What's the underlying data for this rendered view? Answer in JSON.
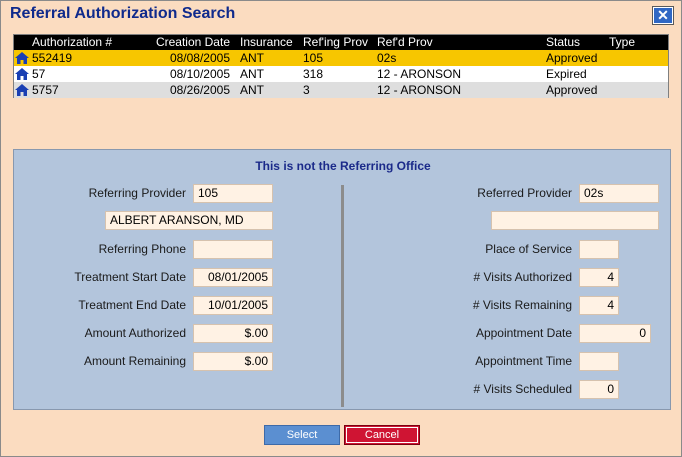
{
  "window": {
    "title": "Referral Authorization Search",
    "close_label": "✕"
  },
  "grid": {
    "headers": {
      "auth": "Authorization #",
      "date": "Creation Date",
      "ins": "Insurance",
      "refing": "Ref'ing Prov",
      "refd": "Ref'd Prov",
      "status": "Status",
      "type": "Type"
    },
    "rows": [
      {
        "auth": "552419",
        "date": "08/08/2005",
        "ins": "ANT",
        "refing": "105",
        "refd": "02s",
        "status": "Approved",
        "type": ""
      },
      {
        "auth": "57",
        "date": "08/10/2005",
        "ins": "ANT",
        "refing": "318",
        "refd": "12 - ARONSON",
        "status": "Expired",
        "type": ""
      },
      {
        "auth": "5757",
        "date": "08/26/2005",
        "ins": "ANT",
        "refing": "3",
        "refd": "12 - ARONSON",
        "status": "Approved",
        "type": ""
      }
    ],
    "row_icon": "house-icon",
    "selected_row_color": "#f7c600"
  },
  "detail": {
    "notice": "This is not the Referring Office",
    "left": {
      "referring_provider_label": "Referring Provider",
      "referring_provider_value": "105",
      "referring_provider_name": "ALBERT ARANSON, MD",
      "referring_phone_label": "Referring Phone",
      "referring_phone_value": "",
      "treatment_start_label": "Treatment Start Date",
      "treatment_start_value": "08/01/2005",
      "treatment_end_label": "Treatment End Date",
      "treatment_end_value": "10/01/2005",
      "amount_authorized_label": "Amount Authorized",
      "amount_authorized_value": "$.00",
      "amount_remaining_label": "Amount Remaining",
      "amount_remaining_value": "$.00"
    },
    "right": {
      "referred_provider_label": "Referred Provider",
      "referred_provider_value": "02s",
      "referred_provider_name": "",
      "place_of_service_label": "Place of Service",
      "place_of_service_value": "",
      "visits_authorized_label": "# Visits Authorized",
      "visits_authorized_value": "4",
      "visits_remaining_label": "# Visits Remaining",
      "visits_remaining_value": "4",
      "appointment_date_label": "Appointment Date",
      "appointment_date_value": "0",
      "appointment_time_label": "Appointment Time",
      "appointment_time_value": "",
      "visits_scheduled_label": "# Visits Scheduled",
      "visits_scheduled_value": "0"
    }
  },
  "buttons": {
    "select_label": "Select",
    "cancel_label": "Cancel"
  },
  "colors": {
    "window_bg": "#fbdcc0",
    "panel_bg": "#b3c5dc",
    "title": "#0f2a8c",
    "cancel": "#cf1433",
    "select": "#5b8fd1"
  }
}
